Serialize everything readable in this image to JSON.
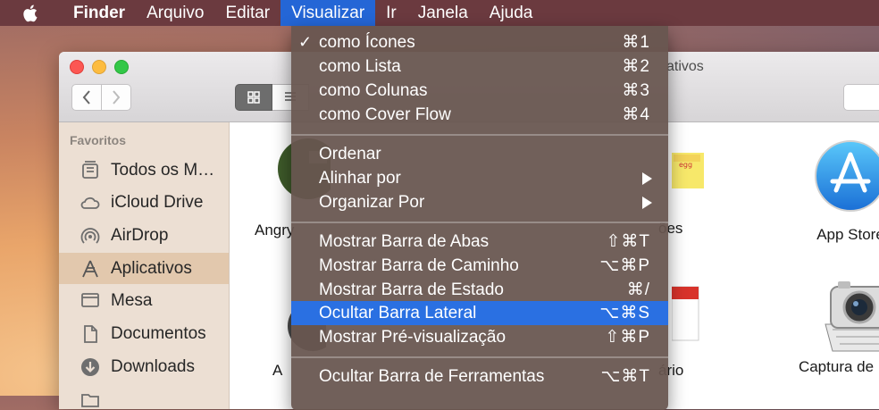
{
  "menubar": {
    "apple": "apple-logo-icon",
    "items": [
      {
        "label": "Finder"
      },
      {
        "label": "Arquivo"
      },
      {
        "label": "Editar"
      },
      {
        "label": "Visualizar"
      },
      {
        "label": "Ir"
      },
      {
        "label": "Janela"
      },
      {
        "label": "Ajuda"
      }
    ]
  },
  "window": {
    "title": "ativos"
  },
  "sidebar": {
    "heading": "Favoritos",
    "items": [
      {
        "label": "Todos os M…",
        "icon": "all-files-icon"
      },
      {
        "label": "iCloud Drive",
        "icon": "cloud-icon"
      },
      {
        "label": "AirDrop",
        "icon": "airdrop-icon"
      },
      {
        "label": "Aplicativos",
        "icon": "applications-icon"
      },
      {
        "label": "Mesa",
        "icon": "desktop-icon"
      },
      {
        "label": "Documentos",
        "icon": "documents-icon"
      },
      {
        "label": "Downloads",
        "icon": "downloads-icon"
      }
    ]
  },
  "files": [
    {
      "label": "Angry",
      "icon": "angry-birds-icon"
    },
    {
      "label": "ões",
      "icon": "stickies-icon"
    },
    {
      "label": "App Store",
      "icon": "app-store-icon"
    },
    {
      "label": "A",
      "icon": "app-icon"
    },
    {
      "label": "ário",
      "icon": "calendar-icon"
    },
    {
      "label": "Captura de Image",
      "icon": "image-capture-icon"
    }
  ],
  "menu": {
    "items": [
      {
        "label": "como Ícones",
        "shortcut": "⌘1",
        "checked": "✓"
      },
      {
        "label": "como Lista",
        "shortcut": "⌘2"
      },
      {
        "label": "como Colunas",
        "shortcut": "⌘3"
      },
      {
        "label": "como Cover Flow",
        "shortcut": "⌘4"
      },
      {
        "label": "Ordenar",
        "shortcut": ""
      },
      {
        "label": "Alinhar por",
        "shortcut": ""
      },
      {
        "label": "Organizar Por",
        "shortcut": ""
      },
      {
        "label": "Mostrar Barra de Abas",
        "shortcut": "⇧⌘T"
      },
      {
        "label": "Mostrar Barra de Caminho",
        "shortcut": "⌥⌘P"
      },
      {
        "label": "Mostrar Barra de Estado",
        "shortcut": "⌘/"
      },
      {
        "label": "Ocultar Barra Lateral",
        "shortcut": "⌥⌘S"
      },
      {
        "label": "Mostrar Pré-visualização",
        "shortcut": "⇧⌘P"
      },
      {
        "label": "Ocultar Barra de Ferramentas",
        "shortcut": "⌥⌘T"
      }
    ]
  },
  "colors": {
    "menubar": "#6b3a3f",
    "highlight": "#2a70e2",
    "sidebar_selected": "#e2c8ad"
  }
}
